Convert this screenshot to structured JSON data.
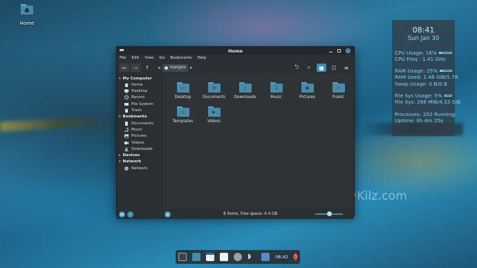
{
  "desktop": {
    "home_icon_label": "Home",
    "watermark": "SpinsbyKilz.com"
  },
  "conky": {
    "time": "08:41",
    "date": "Sun Jan 30",
    "cpu_usage": "CPU Usage: 16%",
    "cpu_usage_fraction": 0.16,
    "cpu_freq": "CPU Freq : 1.41 GHz",
    "ram_usage": "RAM Usage: 25%",
    "ram_usage_fraction": 0.25,
    "ram_used": "RAM Used: 1.48 GiB/5.78",
    "swap_usage": "Swap Usage: 0 B/0 B",
    "fs_usage": "File Sys Usage:  5%",
    "fs_usage_fraction": 0.05,
    "fs_detail": "File Sys: 266 MiB/4.33 GiB",
    "processes": "Processes: 202   Running:",
    "uptime": "Uptime: 0h 4m 25s"
  },
  "window": {
    "title": "Home",
    "menu": [
      "File",
      "Edit",
      "View",
      "Go",
      "Bookmarks",
      "Help"
    ],
    "path_crumb": "manjaro",
    "sidebar": {
      "my_computer": "My Computer",
      "computer_items": [
        "Home",
        "Desktop",
        "Recent",
        "File System",
        "Trash"
      ],
      "bookmarks": "Bookmarks",
      "bookmark_items": [
        "Documents",
        "Music",
        "Pictures",
        "Videos",
        "Downloads"
      ],
      "devices": "Devices",
      "network": "Network",
      "network_items": [
        "Network"
      ]
    },
    "files": [
      "Desktop",
      "Documents",
      "Downloads",
      "Music",
      "Pictures",
      "Public",
      "Templates",
      "Videos"
    ],
    "status": "8 items, Free space: 4.4 GB",
    "zoom_fraction": 0.5
  },
  "dock": {
    "clock": "08:42"
  },
  "colors": {
    "accent": "#3c8fb4",
    "folder": "#4a8aa9",
    "power": "#d72d2d",
    "conky_text": "#7fd3ee"
  }
}
